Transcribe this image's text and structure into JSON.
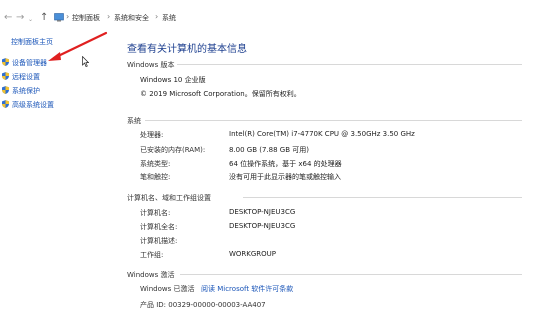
{
  "breadcrumb": {
    "items": [
      "控制面板",
      "系统和安全",
      "系统"
    ]
  },
  "left_pane": {
    "home": "控制面板主页",
    "links": [
      "设备管理器",
      "远程设置",
      "系统保护",
      "高级系统设置"
    ]
  },
  "main": {
    "title": "查看有关计算机的基本信息",
    "windows_edition": {
      "header": "Windows 版本",
      "edition": "Windows 10 企业版",
      "copyright": "© 2019 Microsoft Corporation。保留所有权利。"
    },
    "system": {
      "header": "系统",
      "rows": [
        {
          "label": "处理器:",
          "value": "Intel(R) Core(TM) i7-4770K CPU @ 3.50GHz   3.50 GHz"
        },
        {
          "label": "已安装的内存(RAM):",
          "value": "8.00 GB (7.88 GB 可用)"
        },
        {
          "label": "系统类型:",
          "value": "64 位操作系统，基于 x64 的处理器"
        },
        {
          "label": "笔和触控:",
          "value": "没有可用于此显示器的笔或触控输入"
        }
      ]
    },
    "computer": {
      "header": "计算机名、域和工作组设置",
      "rows": [
        {
          "label": "计算机名:",
          "value": "DESKTOP-NJEU3CG"
        },
        {
          "label": "计算机全名:",
          "value": "DESKTOP-NJEU3CG"
        },
        {
          "label": "计算机描述:",
          "value": ""
        },
        {
          "label": "工作组:",
          "value": "WORKGROUP"
        }
      ]
    },
    "activation": {
      "header": "Windows 激活",
      "status": "Windows 已激活",
      "license_link": "阅读 Microsoft 软件许可条款",
      "product_id": "产品 ID: 00329-00000-00003-AA407"
    }
  },
  "colors": {
    "link": "#1a55b8",
    "title": "#1d3f8f",
    "annotation_arrow": "#e02020"
  }
}
